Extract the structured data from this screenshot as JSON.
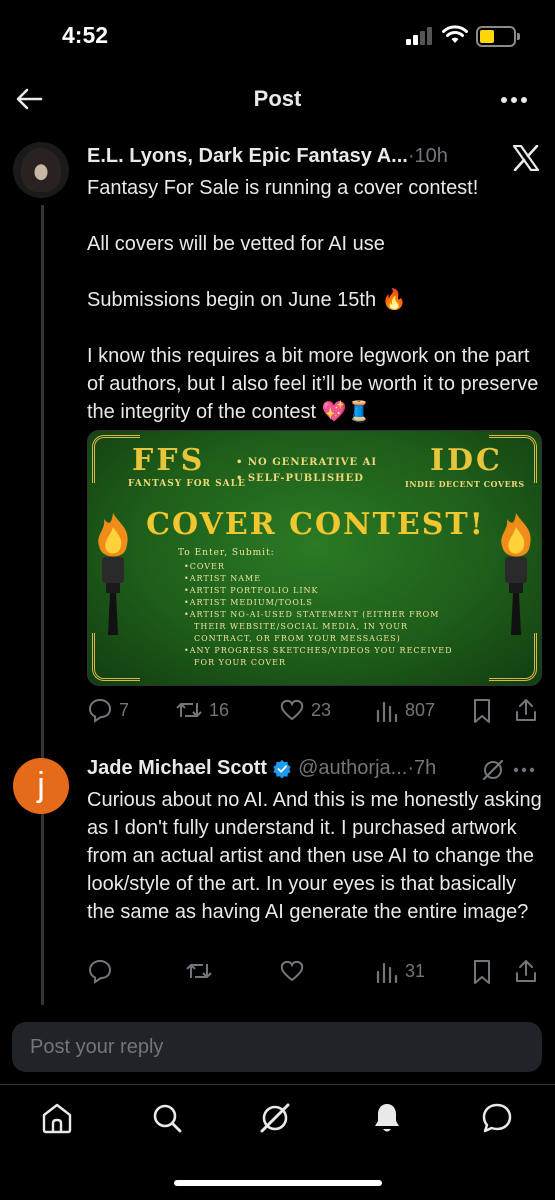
{
  "status_bar": {
    "time": "4:52"
  },
  "header": {
    "title": "Post"
  },
  "post": {
    "author_name": "E.L. Lyons, Dark Epic Fantasy A...",
    "timestamp": "·10h",
    "paragraphs": [
      "Fantasy For Sale is running a cover contest!",
      "All covers will be vetted for AI use",
      "Submissions begin on June 15th 🔥",
      "I know this requires a bit more legwork on the part of authors, but I also feel it’ll be worth it to preserve the integrity of the contest 💖🧵"
    ],
    "image": {
      "ffs": "FFS",
      "ffs_sub": "Fantasy For Sale",
      "bullets": [
        "• No Generative AI",
        "• Self-Published"
      ],
      "idc": "IDC",
      "idc_sub": "Indie Decent Covers",
      "headline": "Cover Contest!",
      "enter_label": "To Enter, Submit:",
      "items": [
        "Cover",
        "Artist Name",
        "Artist Portfolio Link",
        "Artist Medium/Tools",
        "Artist No-AI-Used Statement (either from",
        "their website/social media, in your",
        "contract, or from your messages)",
        "Any progress sketches/videos you received",
        "for your cover"
      ]
    },
    "stats": {
      "replies": "7",
      "reposts": "16",
      "likes": "23",
      "views": "807"
    }
  },
  "reply": {
    "avatar_letter": "j",
    "author_name": "Jade Michael Scott",
    "handle": "@authorja...",
    "timestamp": "·7h",
    "text": "Curious about no AI. And this is me honestly asking as I don't fully understand it. I purchased artwork from an actual artist and then use AI to change the look/style of the art. In your eyes is that basically the same as having AI generate the entire image?",
    "stats": {
      "views": "31"
    }
  },
  "composer": {
    "placeholder": "Post your reply"
  },
  "colors": {
    "accent": "#1d9bf0",
    "muted": "#71767b",
    "avatar_orange": "#e56a1a",
    "battery": "#ffd60a"
  }
}
